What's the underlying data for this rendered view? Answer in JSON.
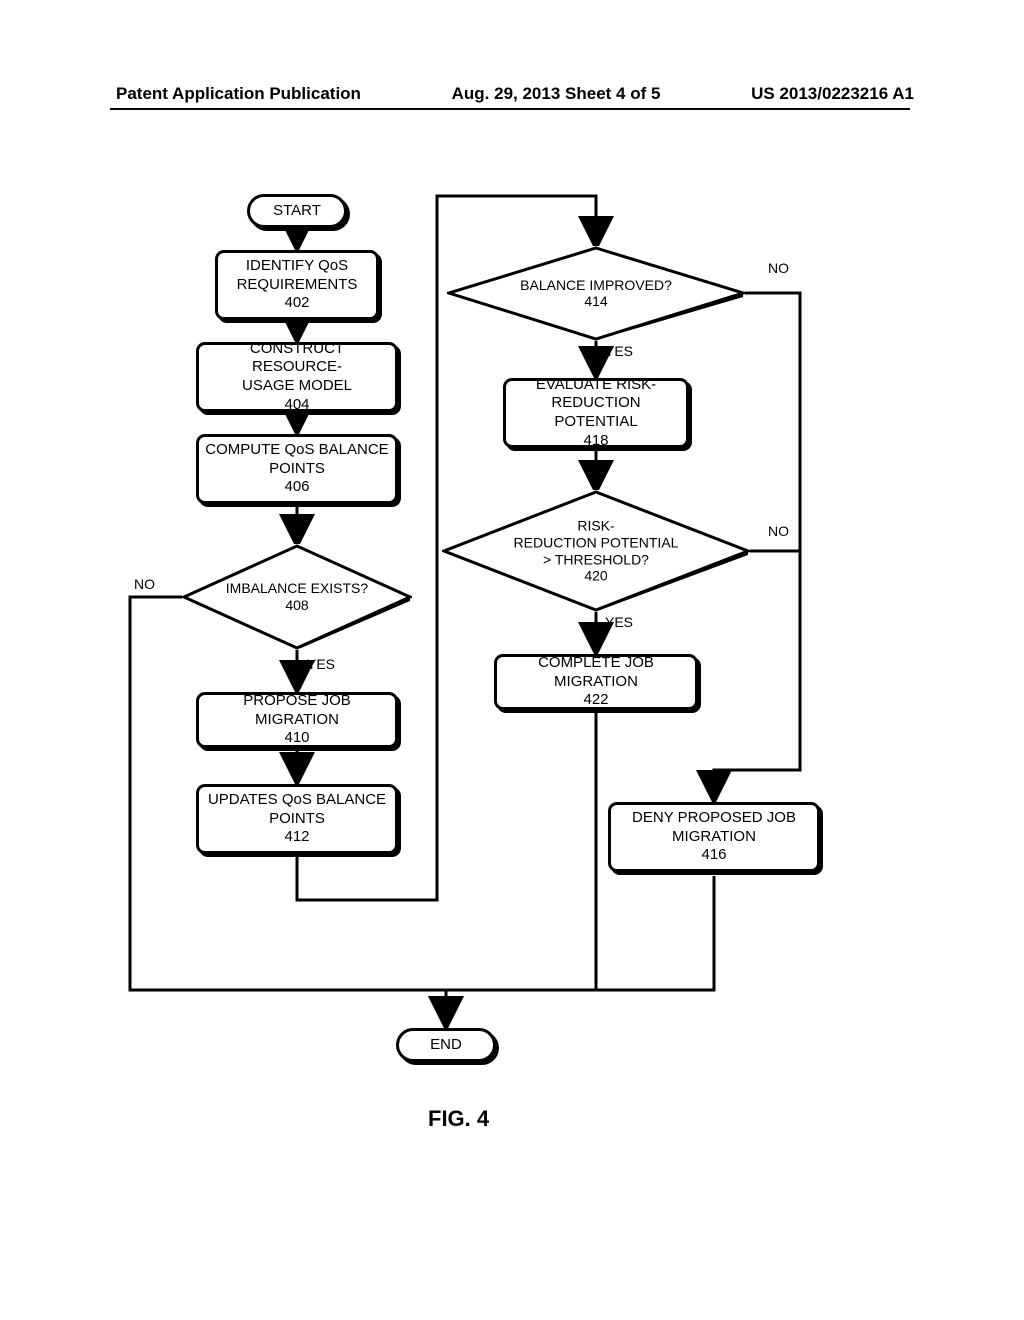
{
  "header": {
    "left": "Patent Application Publication",
    "center": "Aug. 29, 2013  Sheet 4 of 5",
    "right": "US 2013/0223216 A1"
  },
  "labels": {
    "yes": "YES",
    "no": "NO"
  },
  "terminators": {
    "start": "START",
    "end": "END"
  },
  "steps": {
    "s402": {
      "line1": "IDENTIFY QoS",
      "line2": "REQUIREMENTS",
      "num": "402"
    },
    "s404": {
      "line1": "CONSTRUCT RESOURCE-",
      "line2": "USAGE MODEL",
      "num": "404"
    },
    "s406": {
      "line1": "COMPUTE QoS BALANCE",
      "line2": "POINTS",
      "num": "406"
    },
    "s410": {
      "line1": "PROPOSE JOB MIGRATION",
      "num": "410"
    },
    "s412": {
      "line1": "UPDATES QoS BALANCE",
      "line2": "POINTS",
      "num": "412"
    },
    "s416": {
      "line1": "DENY PROPOSED JOB",
      "line2": "MIGRATION",
      "num": "416"
    },
    "s418": {
      "line1": "EVALUATE RISK-",
      "line2": "REDUCTION POTENTIAL",
      "num": "418"
    },
    "s422": {
      "line1": "COMPLETE JOB MIGRATION",
      "num": "422"
    }
  },
  "decisions": {
    "d408": {
      "line1": "IMBALANCE EXISTS?",
      "num": "408"
    },
    "d414": {
      "line1": "BALANCE IMPROVED?",
      "num": "414"
    },
    "d420": {
      "line1": "RISK-",
      "line2": "REDUCTION POTENTIAL",
      "line3": "> THRESHOLD?",
      "num": "420"
    }
  },
  "figure": "FIG. 4"
}
